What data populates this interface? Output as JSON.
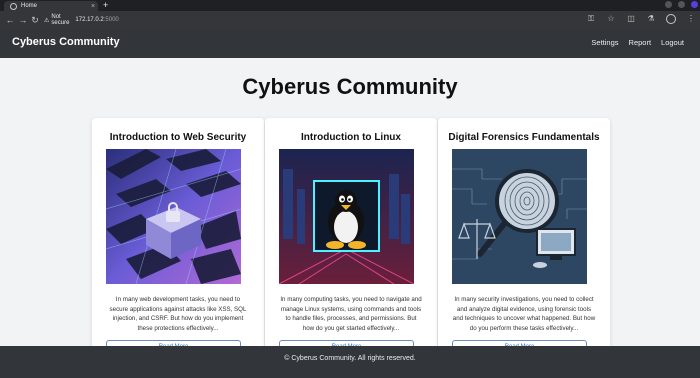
{
  "browser": {
    "tab_title": "Home",
    "tab_close": "×",
    "new_tab": "+",
    "back": "←",
    "forward": "→",
    "reload": "↻",
    "security_label": "Not secure",
    "url_host": "172.17.0.2",
    "url_port": ":5000"
  },
  "site": {
    "brand": "Cyberus Community",
    "nav": [
      "Settings",
      "Report",
      "Logout"
    ]
  },
  "main": {
    "title": "Cyberus Community",
    "cards": [
      {
        "title": "Introduction to Web Security",
        "text": "In many web development tasks, you need to secure applications against attacks like XSS, SQL injection, and CSRF. But how do you implement these protections effectively...",
        "button": "Read More"
      },
      {
        "title": "Introduction to Linux",
        "text": "In many computing tasks, you need to navigate and manage Linux systems, using commands and tools to handle files, processes, and permissions. But how do you get started effectively...",
        "button": "Read More"
      },
      {
        "title": "Digital Forensics Fundamentals",
        "text": "In many security investigations, you need to collect and analyze digital evidence, using forensic tools and techniques to uncover what happened. But how do you perform these tasks effectively...",
        "button": "Read More"
      }
    ]
  },
  "footer": {
    "text": "© Cyberus Community. All rights reserved."
  },
  "colors": {
    "navbar": "#32363b",
    "page_bg": "#f2f3f5",
    "button_border": "#6c8bbf",
    "button_text": "#2f6bc4"
  }
}
